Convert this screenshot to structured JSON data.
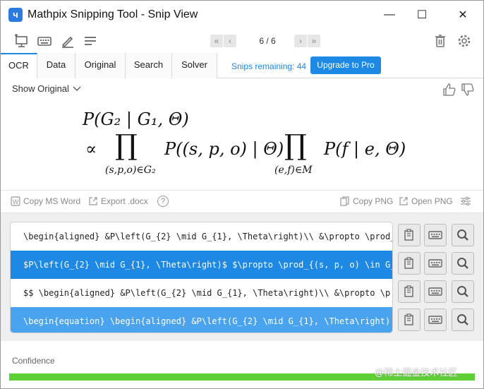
{
  "window": {
    "title": "Mathpix Snipping Tool - Snip View",
    "app_icon_glyph": "ч",
    "minimize": "—",
    "maximize": "☐",
    "close": "✕"
  },
  "toolbar": {
    "icons": [
      "new-snip-icon",
      "keyboard-icon",
      "draw-icon",
      "menu-lines-icon"
    ],
    "page_count": "6 / 6",
    "trash_icon": "trash-icon",
    "settings_icon": "gear-icon"
  },
  "tabs": [
    {
      "label": "OCR",
      "active": true
    },
    {
      "label": "Data"
    },
    {
      "label": "Original"
    },
    {
      "label": "Search"
    },
    {
      "label": "Solver"
    }
  ],
  "snips_remaining": "Snips remaining: 44",
  "upgrade_label": "Upgrade to Pro",
  "show_original": "Show Original",
  "formula": {
    "line1": "P(G₂ | G₁, Θ)",
    "propto": "∝",
    "prod": "∏",
    "sub1": "(s,p,o)∈G₂",
    "mid": "P((s, p, o) | Θ)",
    "sub2": "(e,f)∈M",
    "end": "P(f | e, Θ)"
  },
  "copy_actions": {
    "copy_ms_word": "Copy MS Word",
    "export_docx": "Export .docx",
    "help": "?",
    "copy_png": "Copy PNG",
    "open_png": "Open PNG"
  },
  "code_rows": [
    "\\begin{aligned} &P\\left(G_{2} \\mid G_{1}, \\Theta\\right)\\\\ &\\propto \\prod_",
    "$P\\left(G_{2} \\mid G_{1}, \\Theta\\right)$ $\\propto \\prod_{(s, p, o) \\in G_",
    "$$  \\begin{aligned} &P\\left(G_{2} \\mid G_{1}, \\Theta\\right)\\\\ &\\propto \\p",
    "\\begin{equation}  \\begin{aligned} &P\\left(G_{2} \\mid G_{1}, \\Theta\\right)"
  ],
  "confidence_label": "Confidence",
  "confidence_value": 1.0,
  "watermark": "@稀土掘金技术社区",
  "colors": {
    "accent": "#1e88e5",
    "confidence": "#5ecf35"
  }
}
